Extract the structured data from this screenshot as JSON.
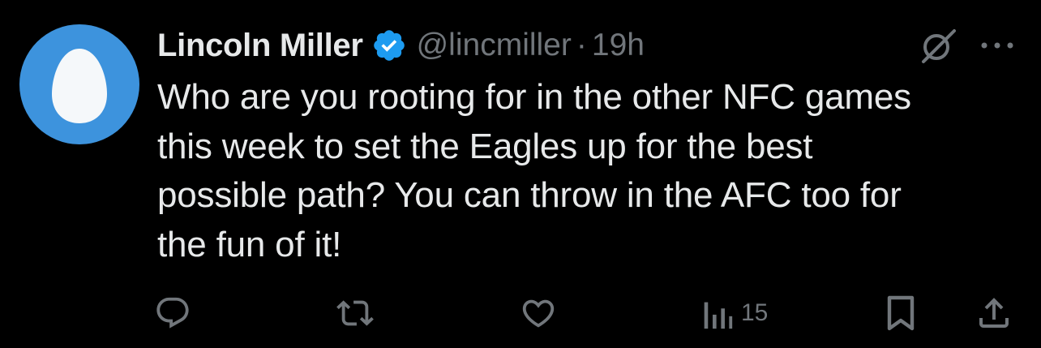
{
  "tweet": {
    "display_name": "Lincoln Miller",
    "handle": "@lincmiller",
    "separator": "·",
    "time": "19h",
    "verified": true,
    "text": "Who are you rooting for in the other NFC games\nthis week to set the Eagles up for the best\npossible path? You can throw in the AFC too for\nthe fun of it!"
  },
  "actions": {
    "views_count": "15"
  },
  "icons": {
    "avatar": "default-egg-avatar",
    "verified": "verified-badge-icon",
    "grok": "grok-icon",
    "more": "more-icon",
    "reply": "reply-icon",
    "retweet": "retweet-icon",
    "like": "heart-icon",
    "views": "analytics-icon",
    "bookmark": "bookmark-icon",
    "share": "share-icon"
  },
  "colors": {
    "background": "#000000",
    "text_primary": "#e7e9ea",
    "text_secondary": "#71767b",
    "verified_blue": "#1d9bf0",
    "avatar_blue": "#3d93dd"
  }
}
